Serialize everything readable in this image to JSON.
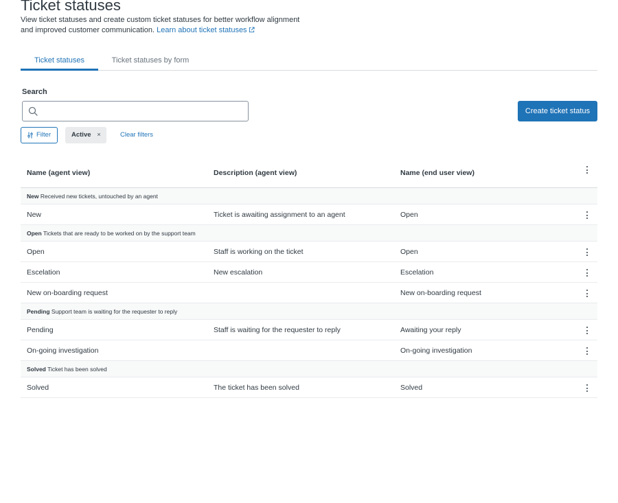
{
  "header": {
    "title": "Ticket statuses",
    "intro_line1": "View ticket statuses and create custom ticket statuses for better workflow alignment",
    "intro_line2": "and improved customer communication.",
    "learn_link": "Learn about ticket statuses"
  },
  "tabs": [
    {
      "label": "Ticket statuses",
      "active": true
    },
    {
      "label": "Ticket statuses by form",
      "active": false
    }
  ],
  "search": {
    "label": "Search",
    "value": "",
    "placeholder": ""
  },
  "create_button": "Create ticket status",
  "filter_button": "Filter",
  "active_filter": {
    "label": "Active",
    "close": "×"
  },
  "clear_filters": "Clear filters",
  "table": {
    "columns": [
      "Name (agent view)",
      "Description (agent view)",
      "Name (end user view)"
    ],
    "groups": [
      {
        "title": "New",
        "description": "Received new tickets, untouched by an agent",
        "rows": [
          {
            "agent_name": "New",
            "description": "Ticket is awaiting assignment to an agent",
            "end_user_name": "Open"
          }
        ]
      },
      {
        "title": "Open",
        "description": "Tickets that are ready to be worked on by the support team",
        "rows": [
          {
            "agent_name": "Open",
            "description": "Staff is working on the ticket",
            "end_user_name": "Open"
          },
          {
            "agent_name": "Escelation",
            "description": "New escalation",
            "end_user_name": "Escelation"
          },
          {
            "agent_name": "New on-boarding request",
            "description": "",
            "end_user_name": "New on-boarding request"
          }
        ]
      },
      {
        "title": "Pending",
        "description": "Support team is waiting for the requester to reply",
        "rows": [
          {
            "agent_name": "Pending",
            "description": "Staff is waiting for the requester to reply",
            "end_user_name": "Awaiting your reply"
          },
          {
            "agent_name": "On-going investigation",
            "description": "",
            "end_user_name": "On-going investigation"
          }
        ]
      },
      {
        "title": "Solved",
        "description": "Ticket has been solved",
        "rows": [
          {
            "agent_name": "Solved",
            "description": "The ticket has been solved",
            "end_user_name": "Solved"
          }
        ]
      }
    ]
  },
  "colors": {
    "accent": "#1f73b7",
    "text": "#2f3941",
    "muted": "#68737d",
    "border": "#d8dcde"
  }
}
